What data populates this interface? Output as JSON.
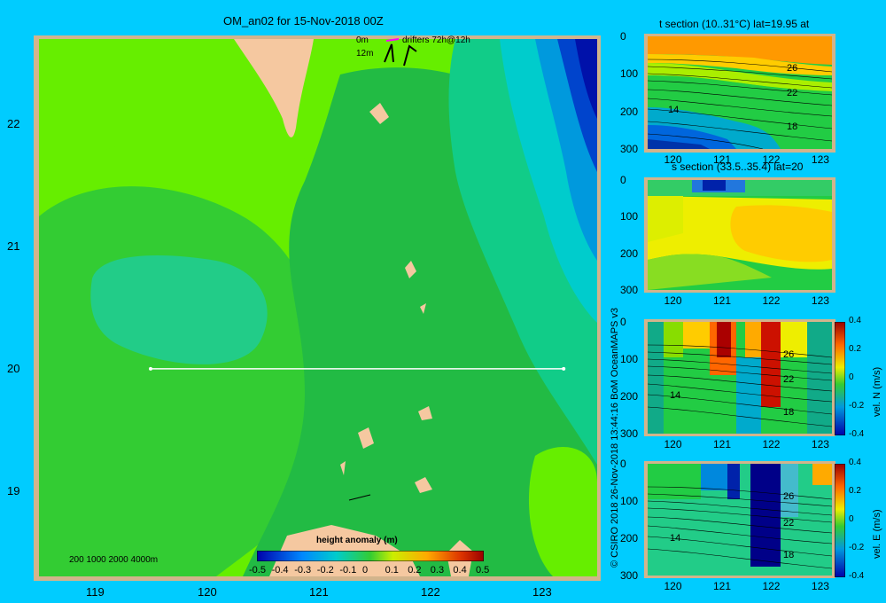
{
  "map": {
    "title": "OM_an02 for 15-Nov-2018 00Z",
    "drifter_depths": [
      "0m",
      "12m"
    ],
    "drifter_label": "drifters 72h@12h",
    "bathy_label": "200  1000  2000  4000m",
    "colorbar_title": "height anomaly (m)",
    "colorbar_ticks": [
      "-0.5",
      "-0.4",
      "-0.3",
      "-0.2",
      "-0.1",
      "0",
      "0.1",
      "0.2",
      "0.3",
      "0.4",
      "0.5"
    ],
    "section_line_lat": 20,
    "section_line_lon": [
      119.5,
      123.2
    ]
  },
  "chart_data": [
    {
      "type": "heatmap",
      "title": "OM_an02 for 15-Nov-2018 00Z",
      "xlim": [
        118.5,
        123.5
      ],
      "ylim": [
        18.3,
        22.7
      ],
      "xticks": [
        119,
        120,
        121,
        122,
        123
      ],
      "yticks": [
        19,
        20,
        21,
        22
      ],
      "colorbar": {
        "label": "height anomaly (m)",
        "range": [
          -0.5,
          0.5
        ]
      }
    },
    {
      "type": "heatmap",
      "title": "t section (10..31°C) lat=19.95 at",
      "xticks": [
        120,
        121,
        122,
        123
      ],
      "yticks": [
        0,
        100,
        200,
        300
      ],
      "contour_labels": [
        "26",
        "22",
        "18",
        "14"
      ]
    },
    {
      "type": "heatmap",
      "title": "s section (33.5..35.4) lat=20",
      "xticks": [
        120,
        121,
        122,
        123
      ],
      "yticks": [
        0,
        100,
        200,
        300
      ]
    },
    {
      "type": "heatmap",
      "title": "",
      "xticks": [
        120,
        121,
        122,
        123
      ],
      "yticks": [
        0,
        100,
        200,
        300
      ],
      "contour_labels": [
        "26",
        "22",
        "18",
        "14"
      ],
      "colorbar": {
        "label": "vel. N (m/s)",
        "ticks": [
          "0.4",
          "0.2",
          "0",
          "-0.2",
          "-0.4"
        ]
      }
    },
    {
      "type": "heatmap",
      "title": "",
      "xticks": [
        120,
        121,
        122,
        123
      ],
      "yticks": [
        0,
        100,
        200,
        300
      ],
      "contour_labels": [
        "26",
        "22",
        "18",
        "14"
      ],
      "colorbar": {
        "label": "vel. E (m/s)",
        "ticks": [
          "0.4",
          "0.2",
          "0",
          "-0.2",
          "-0.4"
        ]
      }
    }
  ],
  "credit": "© CSIRO 2018   26-Nov-2018 13:44:16 BoM OceanMAPS v3"
}
